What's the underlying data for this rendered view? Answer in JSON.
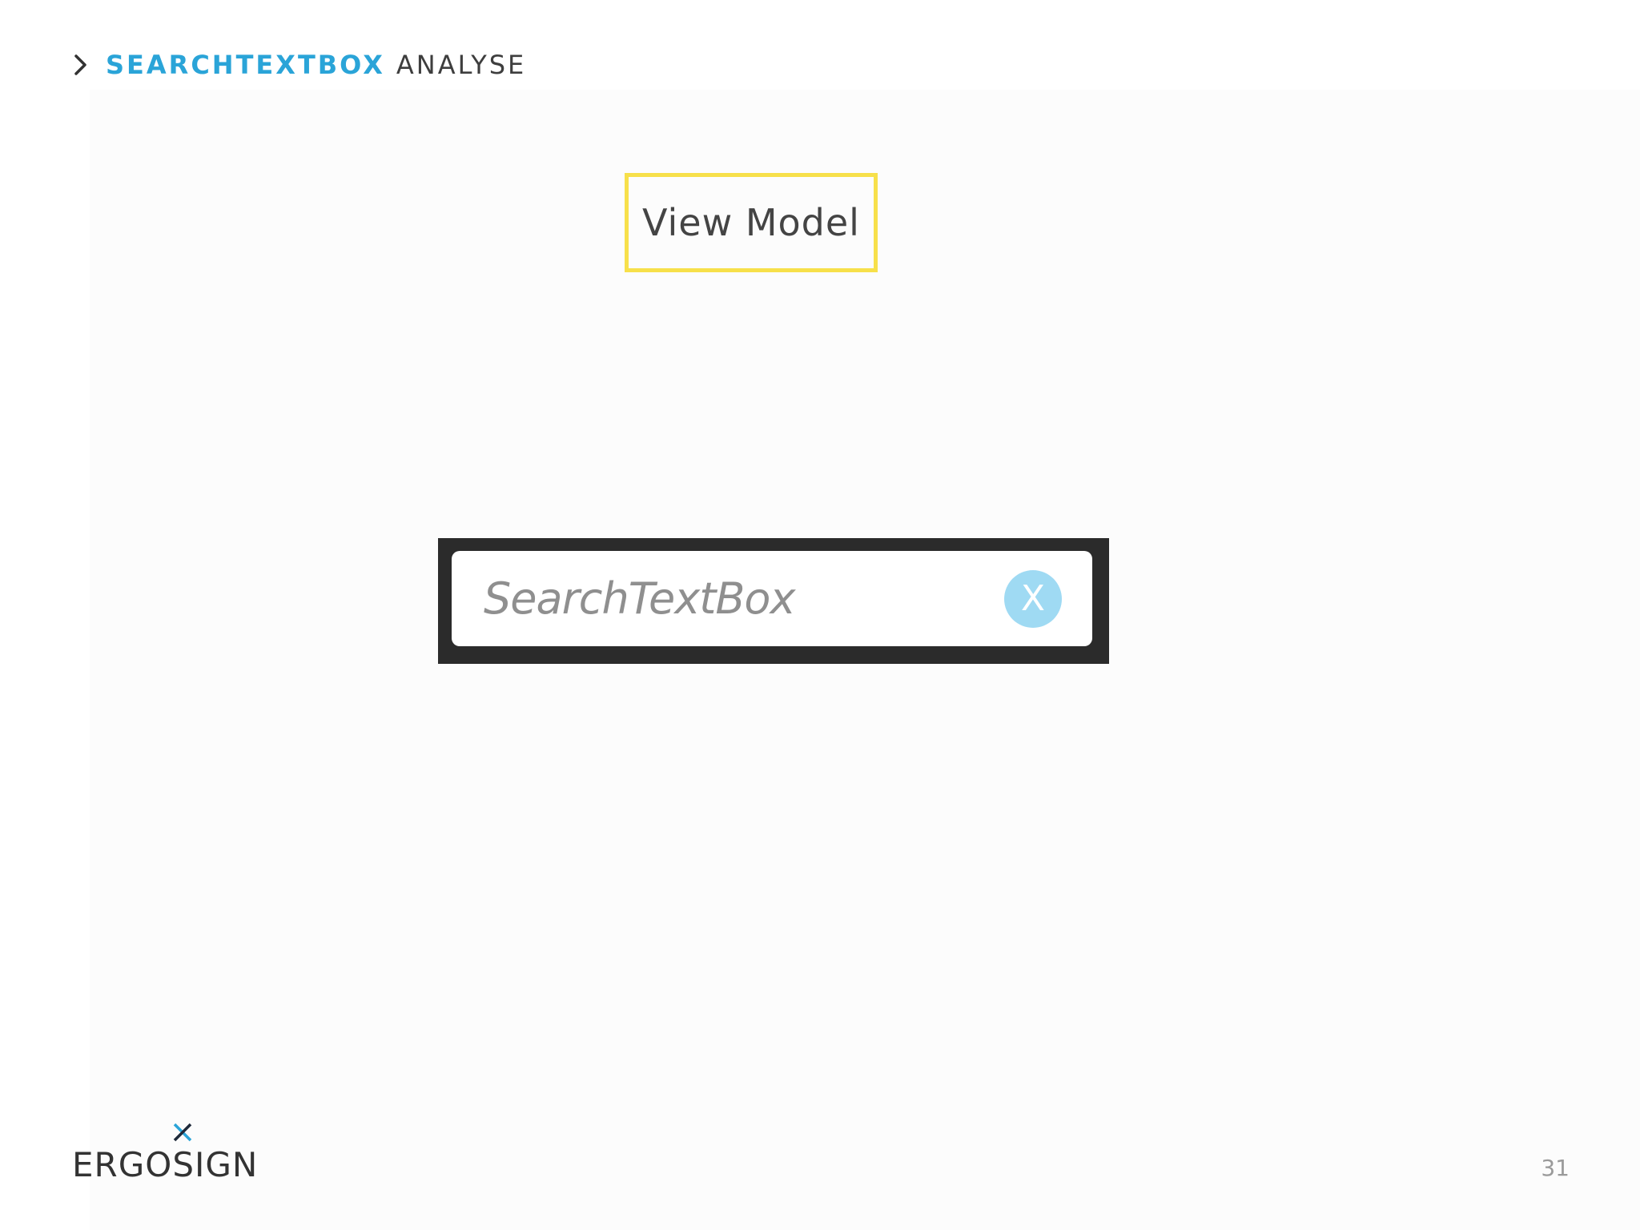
{
  "header": {
    "title_strong": "SEARCHTEXTBOX",
    "title_light": "ANALYSE",
    "icon": "chevron-right-icon"
  },
  "diagram": {
    "view_model_label": "View Model",
    "view_model_border_color": "#f7e04a"
  },
  "search": {
    "placeholder": "SearchTextBox",
    "clear_label": "X",
    "clear_color": "#9fdaf3"
  },
  "footer": {
    "logo_text": "ERGOSIGN",
    "page_number": "31"
  },
  "colors": {
    "accent": "#2aa4d8",
    "frame": "#2b2b2b"
  }
}
